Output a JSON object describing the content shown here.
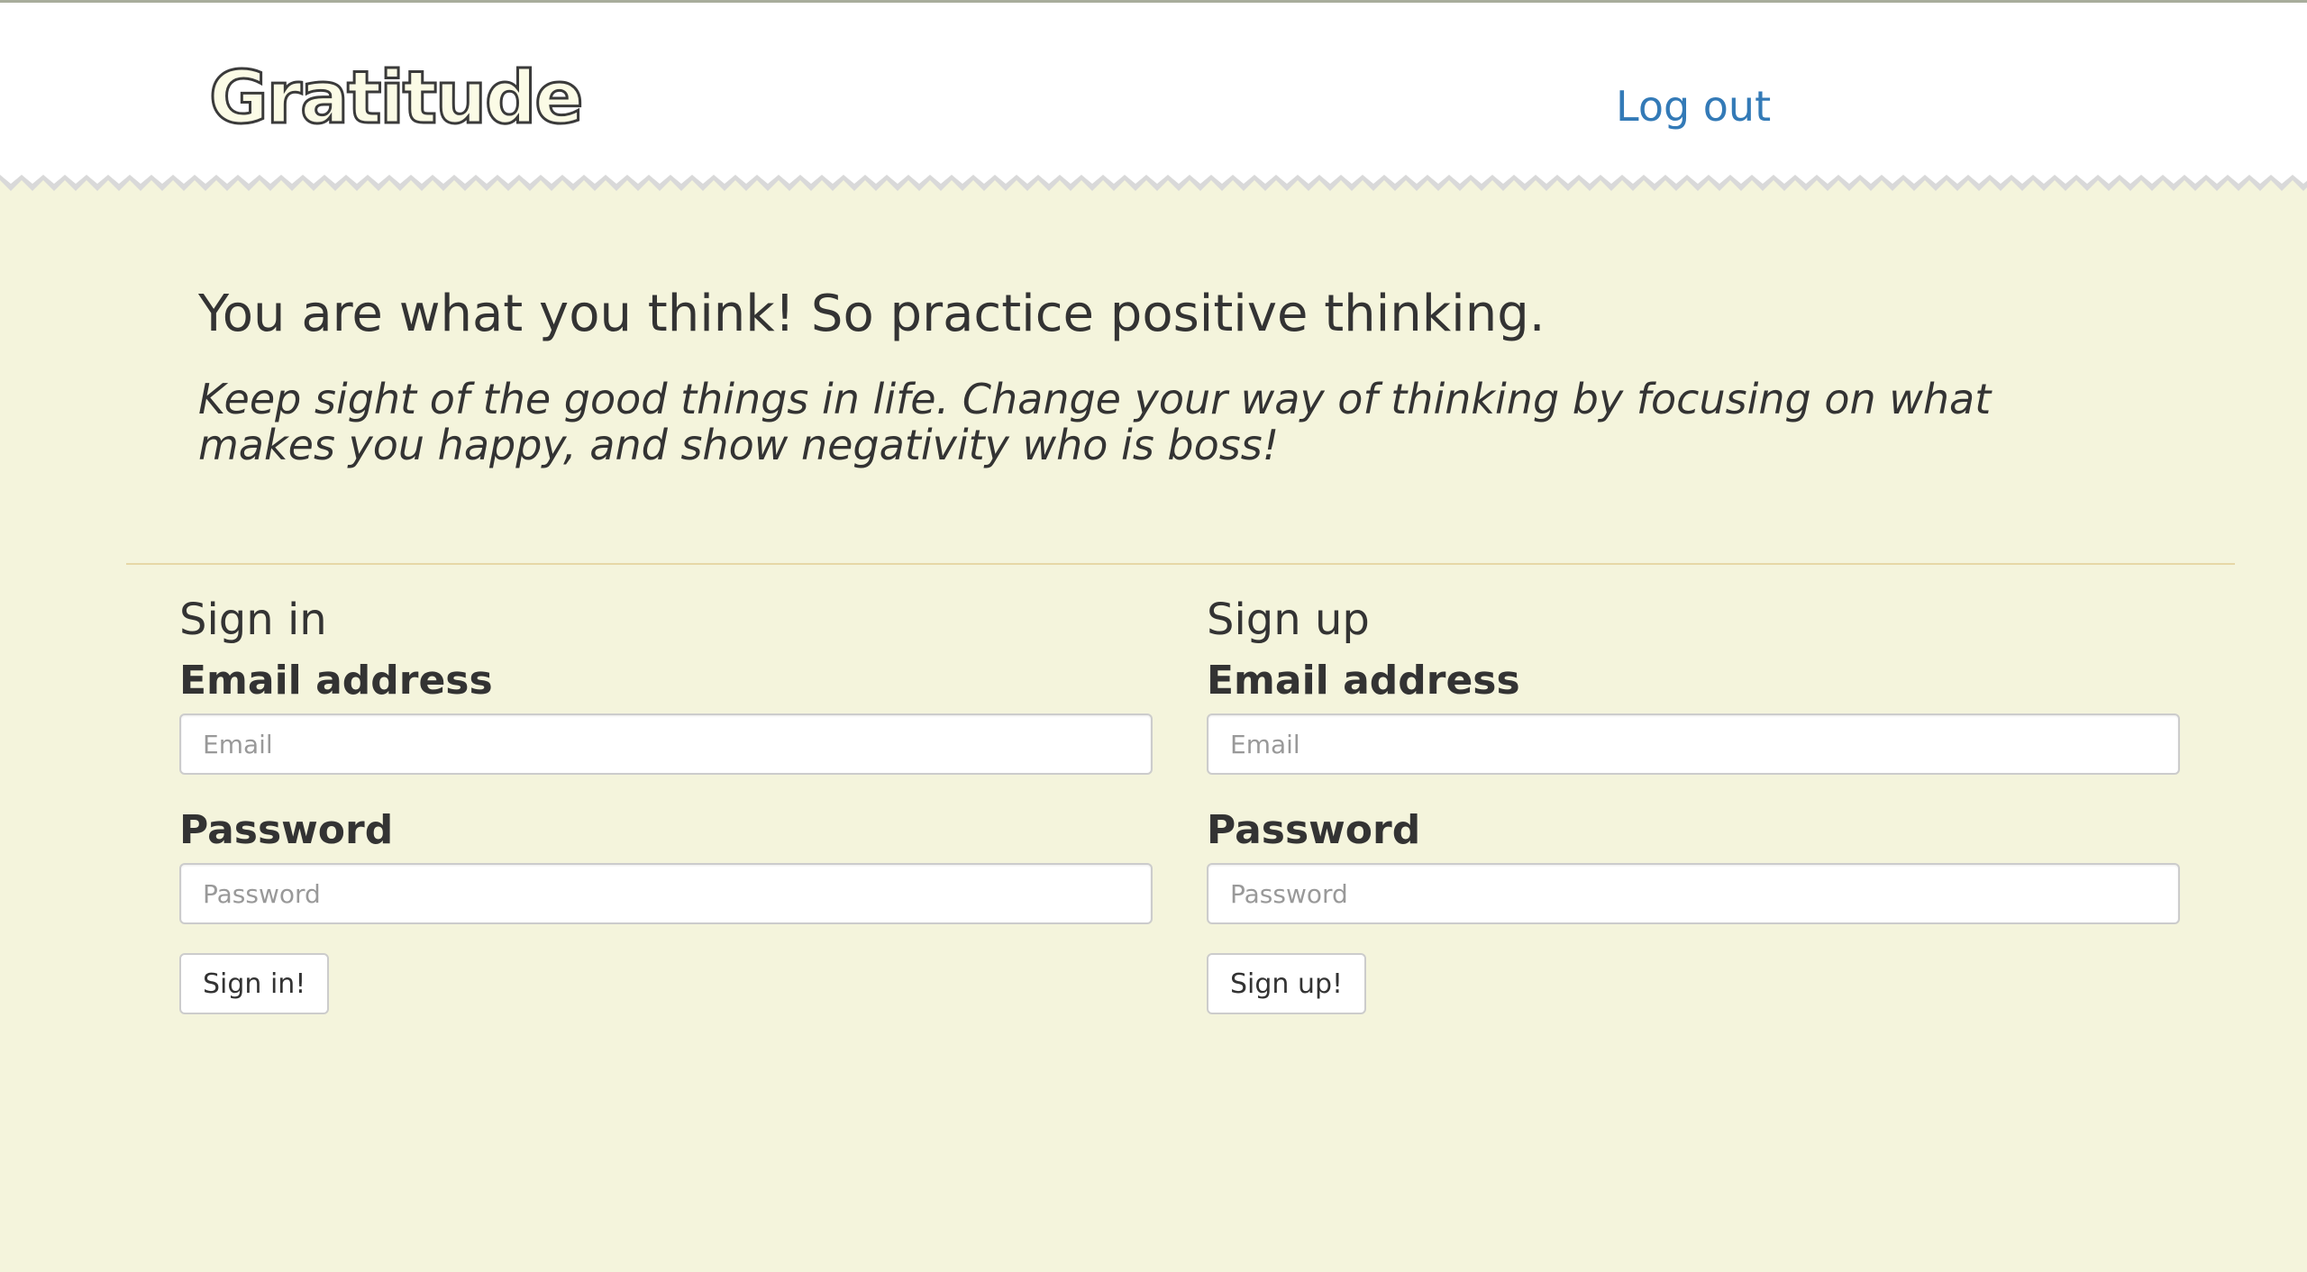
{
  "header": {
    "logo": "Gratitude",
    "logout_label": "Log out"
  },
  "hero": {
    "title": "You are what you think! So practice positive thinking.",
    "subtitle": "Keep sight of the good things in life. Change your way of thinking by focusing on what makes you happy, and show negativity who is boss!"
  },
  "signin": {
    "heading": "Sign in",
    "email_label": "Email address",
    "email_placeholder": "Email",
    "password_label": "Password",
    "password_placeholder": "Password",
    "button_label": "Sign in!"
  },
  "signup": {
    "heading": "Sign up",
    "email_label": "Email address",
    "email_placeholder": "Email",
    "password_label": "Password",
    "password_placeholder": "Password",
    "button_label": "Sign up!"
  },
  "colors": {
    "page_background": "#f4f4dc",
    "header_background": "#ffffff",
    "link": "#337ab7",
    "divider": "#e6d7a6",
    "zigzag": "#d9d9d9"
  }
}
